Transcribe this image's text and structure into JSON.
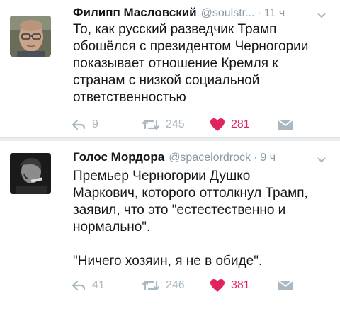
{
  "tweets": [
    {
      "name": "Филипп Масловский",
      "handle": "@soulstr...",
      "time": "11 ч",
      "text": "То, как русский разведчик Трамп\nобошёлся с президентом Черногории\nпоказывает отношение Кремля к\nстранам с низкой социальной\nответственностью",
      "replies": "9",
      "retweets": "245",
      "likes": "281"
    },
    {
      "name": "Голос Мордора",
      "handle": "@spacelordrock",
      "time": "9 ч",
      "text": "Премьер Черногории Душко\nМаркович, которого оттолкнул Трамп,\nзаявил, что это \"естестественно и\nнормально\".\n\n\"Ничего хозяин, я не в обиде\".",
      "replies": "41",
      "retweets": "246",
      "likes": "381"
    }
  ],
  "colors": {
    "text": "#14171a",
    "muted": "#8899a6",
    "icon": "#aab8c2",
    "like": "#e0245e",
    "divider": "#ebeef0"
  }
}
